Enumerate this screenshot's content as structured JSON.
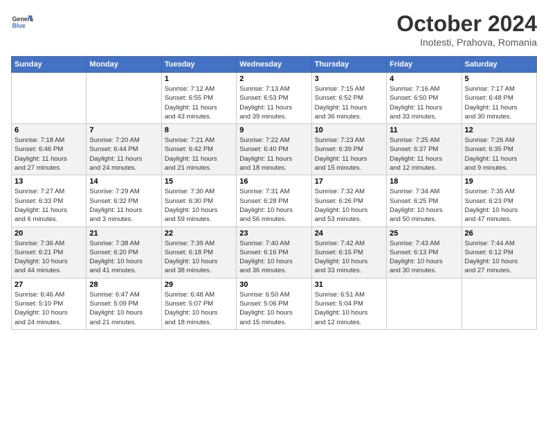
{
  "header": {
    "logo_line1": "General",
    "logo_line2": "Blue",
    "month": "October 2024",
    "location": "Inotesti, Prahova, Romania"
  },
  "days_of_week": [
    "Sunday",
    "Monday",
    "Tuesday",
    "Wednesday",
    "Thursday",
    "Friday",
    "Saturday"
  ],
  "weeks": [
    [
      {
        "day": "",
        "info": ""
      },
      {
        "day": "",
        "info": ""
      },
      {
        "day": "1",
        "info": "Sunrise: 7:12 AM\nSunset: 6:55 PM\nDaylight: 11 hours\nand 43 minutes."
      },
      {
        "day": "2",
        "info": "Sunrise: 7:13 AM\nSunset: 6:53 PM\nDaylight: 11 hours\nand 39 minutes."
      },
      {
        "day": "3",
        "info": "Sunrise: 7:15 AM\nSunset: 6:52 PM\nDaylight: 11 hours\nand 36 minutes."
      },
      {
        "day": "4",
        "info": "Sunrise: 7:16 AM\nSunset: 6:50 PM\nDaylight: 11 hours\nand 33 minutes."
      },
      {
        "day": "5",
        "info": "Sunrise: 7:17 AM\nSunset: 6:48 PM\nDaylight: 11 hours\nand 30 minutes."
      }
    ],
    [
      {
        "day": "6",
        "info": "Sunrise: 7:18 AM\nSunset: 6:46 PM\nDaylight: 11 hours\nand 27 minutes."
      },
      {
        "day": "7",
        "info": "Sunrise: 7:20 AM\nSunset: 6:44 PM\nDaylight: 11 hours\nand 24 minutes."
      },
      {
        "day": "8",
        "info": "Sunrise: 7:21 AM\nSunset: 6:42 PM\nDaylight: 11 hours\nand 21 minutes."
      },
      {
        "day": "9",
        "info": "Sunrise: 7:22 AM\nSunset: 6:40 PM\nDaylight: 11 hours\nand 18 minutes."
      },
      {
        "day": "10",
        "info": "Sunrise: 7:23 AM\nSunset: 6:39 PM\nDaylight: 11 hours\nand 15 minutes."
      },
      {
        "day": "11",
        "info": "Sunrise: 7:25 AM\nSunset: 6:37 PM\nDaylight: 11 hours\nand 12 minutes."
      },
      {
        "day": "12",
        "info": "Sunrise: 7:26 AM\nSunset: 6:35 PM\nDaylight: 11 hours\nand 9 minutes."
      }
    ],
    [
      {
        "day": "13",
        "info": "Sunrise: 7:27 AM\nSunset: 6:33 PM\nDaylight: 11 hours\nand 6 minutes."
      },
      {
        "day": "14",
        "info": "Sunrise: 7:29 AM\nSunset: 6:32 PM\nDaylight: 11 hours\nand 3 minutes."
      },
      {
        "day": "15",
        "info": "Sunrise: 7:30 AM\nSunset: 6:30 PM\nDaylight: 10 hours\nand 59 minutes."
      },
      {
        "day": "16",
        "info": "Sunrise: 7:31 AM\nSunset: 6:28 PM\nDaylight: 10 hours\nand 56 minutes."
      },
      {
        "day": "17",
        "info": "Sunrise: 7:32 AM\nSunset: 6:26 PM\nDaylight: 10 hours\nand 53 minutes."
      },
      {
        "day": "18",
        "info": "Sunrise: 7:34 AM\nSunset: 6:25 PM\nDaylight: 10 hours\nand 50 minutes."
      },
      {
        "day": "19",
        "info": "Sunrise: 7:35 AM\nSunset: 6:23 PM\nDaylight: 10 hours\nand 47 minutes."
      }
    ],
    [
      {
        "day": "20",
        "info": "Sunrise: 7:36 AM\nSunset: 6:21 PM\nDaylight: 10 hours\nand 44 minutes."
      },
      {
        "day": "21",
        "info": "Sunrise: 7:38 AM\nSunset: 6:20 PM\nDaylight: 10 hours\nand 41 minutes."
      },
      {
        "day": "22",
        "info": "Sunrise: 7:39 AM\nSunset: 6:18 PM\nDaylight: 10 hours\nand 38 minutes."
      },
      {
        "day": "23",
        "info": "Sunrise: 7:40 AM\nSunset: 6:16 PM\nDaylight: 10 hours\nand 36 minutes."
      },
      {
        "day": "24",
        "info": "Sunrise: 7:42 AM\nSunset: 6:15 PM\nDaylight: 10 hours\nand 33 minutes."
      },
      {
        "day": "25",
        "info": "Sunrise: 7:43 AM\nSunset: 6:13 PM\nDaylight: 10 hours\nand 30 minutes."
      },
      {
        "day": "26",
        "info": "Sunrise: 7:44 AM\nSunset: 6:12 PM\nDaylight: 10 hours\nand 27 minutes."
      }
    ],
    [
      {
        "day": "27",
        "info": "Sunrise: 6:46 AM\nSunset: 5:10 PM\nDaylight: 10 hours\nand 24 minutes."
      },
      {
        "day": "28",
        "info": "Sunrise: 6:47 AM\nSunset: 5:09 PM\nDaylight: 10 hours\nand 21 minutes."
      },
      {
        "day": "29",
        "info": "Sunrise: 6:48 AM\nSunset: 5:07 PM\nDaylight: 10 hours\nand 18 minutes."
      },
      {
        "day": "30",
        "info": "Sunrise: 6:50 AM\nSunset: 5:06 PM\nDaylight: 10 hours\nand 15 minutes."
      },
      {
        "day": "31",
        "info": "Sunrise: 6:51 AM\nSunset: 5:04 PM\nDaylight: 10 hours\nand 12 minutes."
      },
      {
        "day": "",
        "info": ""
      },
      {
        "day": "",
        "info": ""
      }
    ]
  ]
}
